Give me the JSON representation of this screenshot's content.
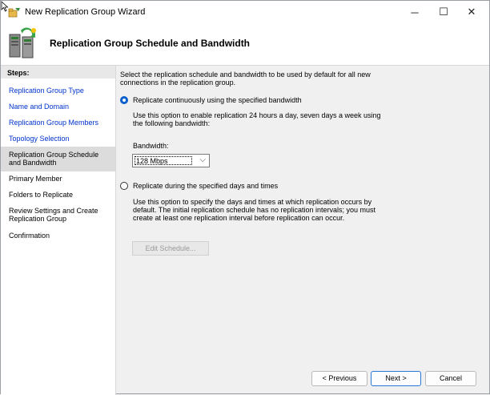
{
  "window": {
    "title": "New Replication Group Wizard",
    "minimize_glyph": "─",
    "maximize_glyph": "☐",
    "close_glyph": "✕"
  },
  "header": {
    "title": "Replication Group Schedule and Bandwidth",
    "icon": "replication-servers-icon"
  },
  "sidebar": {
    "heading": "Steps:",
    "items": [
      {
        "label": "Replication Group Type",
        "state": "link"
      },
      {
        "label": "Name and Domain",
        "state": "link"
      },
      {
        "label": "Replication Group Members",
        "state": "link"
      },
      {
        "label": "Topology Selection",
        "state": "link"
      },
      {
        "label": "Replication Group Schedule and Bandwidth",
        "state": "current"
      },
      {
        "label": "Primary Member",
        "state": "plain"
      },
      {
        "label": "Folders to Replicate",
        "state": "plain"
      },
      {
        "label": "Review Settings and Create Replication Group",
        "state": "plain"
      },
      {
        "label": "Confirmation",
        "state": "plain"
      }
    ]
  },
  "main": {
    "intro": "Select the replication schedule and bandwidth to be used by default for all new connections in the replication group.",
    "option_continuous": {
      "label": "Replicate continuously using the specified bandwidth",
      "checked": true,
      "description": "Use this option to enable replication 24 hours a day, seven days a week using the following bandwidth:"
    },
    "bandwidth": {
      "label": "Bandwidth:",
      "value": "128 Mbps"
    },
    "option_schedule": {
      "label": "Replicate during the specified days and times",
      "checked": false,
      "description": "Use this option to specify the days and times at which replication occurs by default. The initial replication schedule has no replication intervals; you must create at least one replication interval before replication can occur."
    },
    "edit_schedule_label": "Edit Schedule..."
  },
  "footer": {
    "previous_label": "< Previous",
    "next_label": "Next >",
    "cancel_label": "Cancel"
  },
  "colors": {
    "link": "#0033cc",
    "accent": "#0a5fcc",
    "sidebar_current": "#dcdcdc"
  }
}
